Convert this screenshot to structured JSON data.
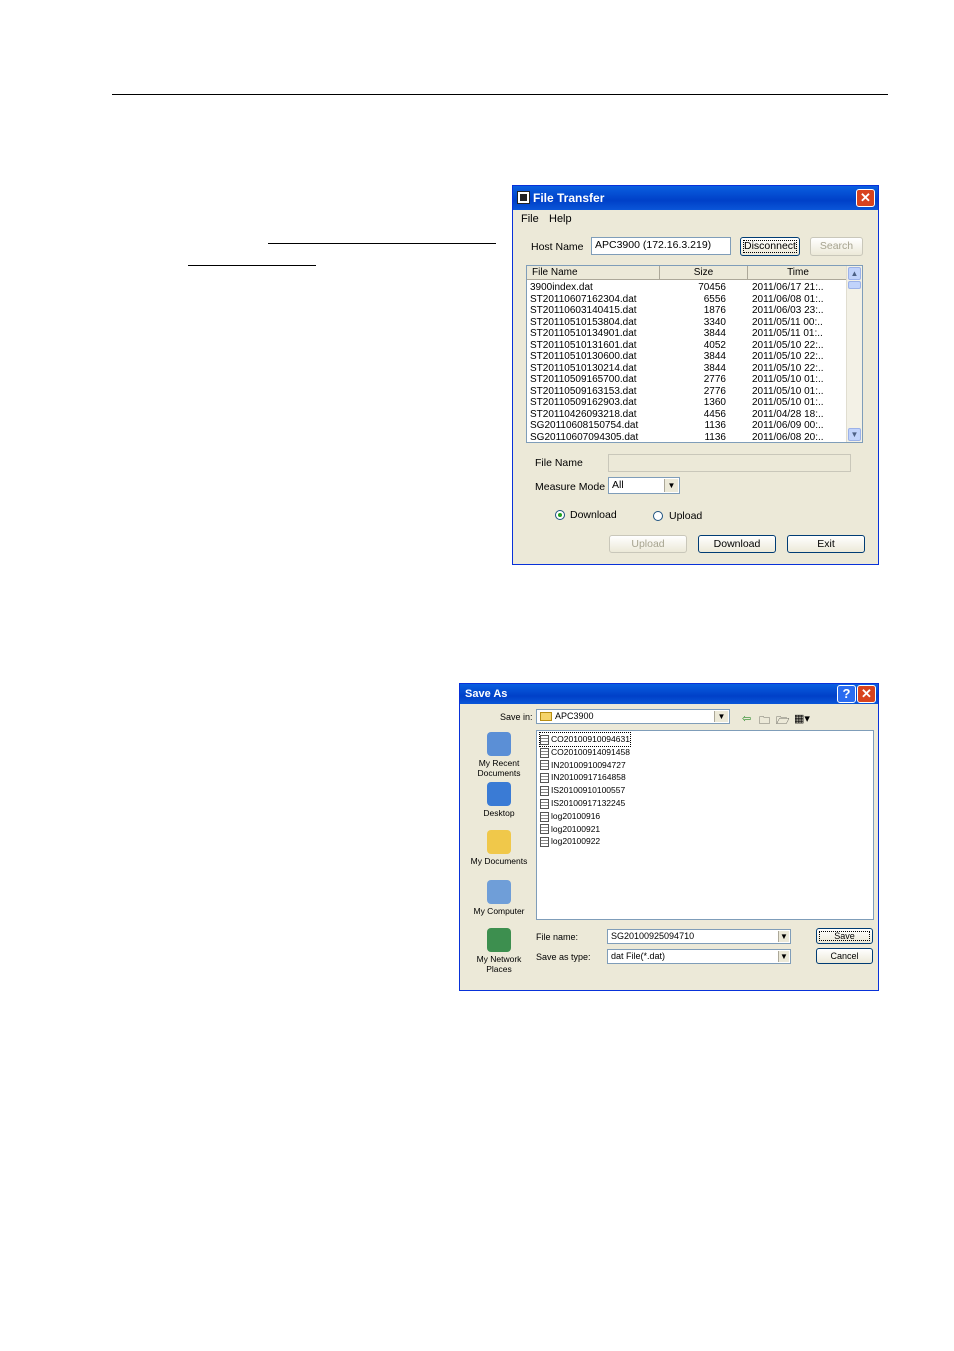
{
  "file_transfer": {
    "title": "File Transfer",
    "menu": [
      "File",
      "Help"
    ],
    "host_label": "Host Name",
    "host_value": "APC3900 (172.16.3.219)",
    "disconnect_label": "Disconnect",
    "search_label": "Search",
    "columns": [
      "File Name",
      "Size",
      "Time"
    ],
    "files": [
      {
        "name": "3900index.dat",
        "size": "70456",
        "time": "2011/06/17 21:.."
      },
      {
        "name": "ST20110607162304.dat",
        "size": "6556",
        "time": "2011/06/08 01:.."
      },
      {
        "name": "ST20110603140415.dat",
        "size": "1876",
        "time": "2011/06/03 23:.."
      },
      {
        "name": "ST20110510153804.dat",
        "size": "3340",
        "time": "2011/05/11 00:.."
      },
      {
        "name": "ST20110510134901.dat",
        "size": "3844",
        "time": "2011/05/11 01:.."
      },
      {
        "name": "ST20110510131601.dat",
        "size": "4052",
        "time": "2011/05/10 22:.."
      },
      {
        "name": "ST20110510130600.dat",
        "size": "3844",
        "time": "2011/05/10 22:.."
      },
      {
        "name": "ST20110510130214.dat",
        "size": "3844",
        "time": "2011/05/10 22:.."
      },
      {
        "name": "ST20110509165700.dat",
        "size": "2776",
        "time": "2011/05/10 01:.."
      },
      {
        "name": "ST20110509163153.dat",
        "size": "2776",
        "time": "2011/05/10 01:.."
      },
      {
        "name": "ST20110509162903.dat",
        "size": "1360",
        "time": "2011/05/10 01:.."
      },
      {
        "name": "ST20110426093218.dat",
        "size": "4456",
        "time": "2011/04/28 18:.."
      },
      {
        "name": "SG20110608150754.dat",
        "size": "1136",
        "time": "2011/06/09 00:.."
      },
      {
        "name": "SG20110607094305.dat",
        "size": "1136",
        "time": "2011/06/08 20:.."
      }
    ],
    "filename_label": "File Name",
    "filename_value": "",
    "measure_mode_label": "Measure Mode",
    "measure_mode_value": "All",
    "radio_download": "Download",
    "radio_upload": "Upload",
    "upload_btn": "Upload",
    "download_btn": "Download",
    "exit_btn": "Exit"
  },
  "save_as": {
    "title": "Save As",
    "save_in_label": "Save in:",
    "save_in_value": "APC3900",
    "places": [
      {
        "label": "My Recent Documents",
        "icon": "recent-documents-icon",
        "color": "#5b8fd6"
      },
      {
        "label": "Desktop",
        "icon": "desktop-icon",
        "color": "#3a7bd5"
      },
      {
        "label": "My Documents",
        "icon": "my-documents-icon",
        "color": "#f0c84a"
      },
      {
        "label": "My Computer",
        "icon": "my-computer-icon",
        "color": "#6f9ed8"
      },
      {
        "label": "My Network Places",
        "icon": "network-places-icon",
        "color": "#3d8f4f"
      }
    ],
    "files": [
      "CO20100910094631",
      "CO20100914091458",
      "IN20100910094727",
      "IN20100917164858",
      "IS20100910100557",
      "IS20100917132245",
      "log20100916",
      "log20100921",
      "log20100922"
    ],
    "file_name_label": "File name:",
    "file_name_value": "SG20100925094710",
    "save_type_label": "Save as type:",
    "save_type_value": "dat File(*.dat)",
    "save_btn": "Save",
    "cancel_btn": "Cancel"
  }
}
